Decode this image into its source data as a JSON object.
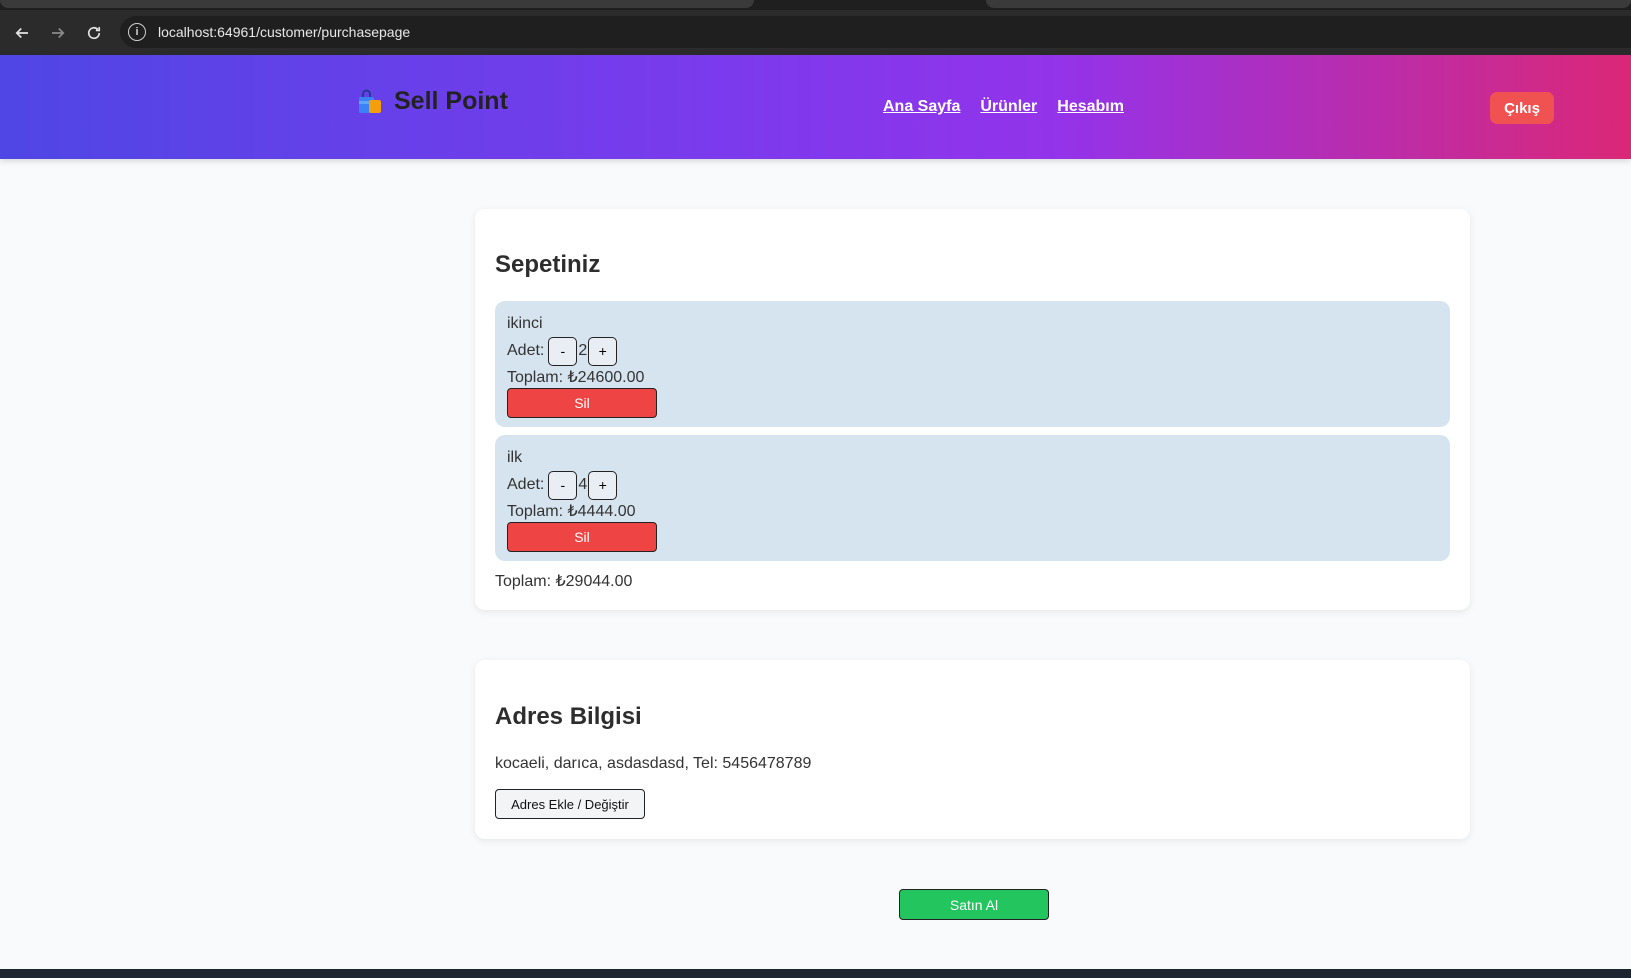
{
  "browser": {
    "url": "localhost:64961/customer/purchasepage",
    "icons": [
      "back-arrow-icon",
      "forward-arrow-icon",
      "reload-icon",
      "site-info-icon"
    ]
  },
  "header": {
    "brand": "Sell Point",
    "brand_icon": "shopping-bag-icon",
    "nav": [
      "Ana Sayfa",
      "Ürünler",
      "Hesabım"
    ],
    "logout_label": "Çıkış"
  },
  "cart": {
    "title": "Sepetiniz",
    "qty_label": "Adet:",
    "minus_label": "-",
    "plus_label": "+",
    "items": [
      {
        "name": "ikinci",
        "quantity": "2",
        "total": "Toplam: ₺24600.00",
        "delete_label": "Sil"
      },
      {
        "name": "ilk",
        "quantity": "4",
        "total": "Toplam: ₺4444.00",
        "delete_label": "Sil"
      }
    ],
    "grand_total": "Toplam: ₺29044.00"
  },
  "address": {
    "title": "Adres Bilgisi",
    "text": "kocaeli, darıca, asdasdasd, Tel: 5456478789",
    "button_label": "Adres Ekle / Değiştir"
  },
  "purchase": {
    "button_label": "Satın Al"
  },
  "colors": {
    "header_gradient_start": "#4f46e5",
    "header_gradient_end": "#db2777",
    "logout": "#f05252",
    "delete": "#ef4444",
    "purchase": "#22c55e",
    "item_bg": "#d6e4f0"
  }
}
